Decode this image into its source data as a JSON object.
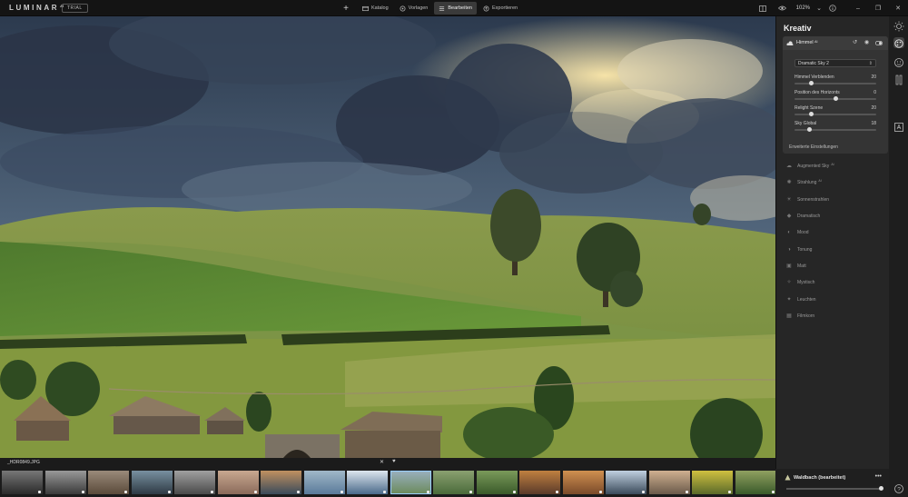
{
  "app": {
    "logo": "LUMINAR",
    "logo_version": "AI",
    "trial_badge": "TRIAL"
  },
  "nav": {
    "add_icon": "plus-icon",
    "tabs": [
      {
        "label": "Katalog",
        "icon": "catalog-icon",
        "active": false
      },
      {
        "label": "Vorlagen",
        "icon": "templates-icon",
        "active": false
      },
      {
        "label": "Bearbeiten",
        "icon": "edit-icon",
        "active": true
      },
      {
        "label": "Exportieren",
        "icon": "export-icon",
        "active": false
      }
    ]
  },
  "toolbar_right": {
    "compare_icon": "compare-icon",
    "preview_icon": "eye-icon",
    "zoom": "102%",
    "zoom_dropdown_icon": "chevron-down-icon",
    "info_icon": "info-icon"
  },
  "window": {
    "minimize": "–",
    "maximize": "❐",
    "close": "✕"
  },
  "panel": {
    "title": "Kreativ",
    "active_tool": {
      "label": "Himmel",
      "badge": "AI",
      "preset": "Dramatic Sky 2",
      "sliders": [
        {
          "label": "Himmel Verblenden",
          "value": "20",
          "fraction": 0.2
        },
        {
          "label": "Position des Horizonts",
          "value": "0",
          "fraction": 0.5
        },
        {
          "label": "Relight Szene",
          "value": "20",
          "fraction": 0.2
        },
        {
          "label": "Sky Global",
          "value": "18",
          "fraction": 0.18
        }
      ],
      "advanced": "Erweiterte Einstellungen"
    },
    "tools": [
      {
        "label": "Augmented Sky",
        "badge": "AI",
        "icon": "sky-icon"
      },
      {
        "label": "Strahlung",
        "badge": "AI",
        "icon": "radiance-icon"
      },
      {
        "label": "Sonnenstrahlen",
        "badge": "",
        "icon": "sunrays-icon"
      },
      {
        "label": "Dramatisch",
        "badge": "",
        "icon": "dramatic-icon"
      },
      {
        "label": "Mood",
        "badge": "",
        "icon": "mood-icon"
      },
      {
        "label": "Tonung",
        "badge": "",
        "icon": "toning-icon"
      },
      {
        "label": "Matt",
        "badge": "",
        "icon": "matte-icon"
      },
      {
        "label": "Mystisch",
        "badge": "",
        "icon": "mystic-icon"
      },
      {
        "label": "Leuchten",
        "badge": "",
        "icon": "glow-icon"
      },
      {
        "label": "Filmkorn",
        "badge": "",
        "icon": "grain-icon"
      }
    ]
  },
  "rail": {
    "icons": [
      "essentials-icon",
      "creative-icon",
      "portrait-icon",
      "professional-icon",
      "canvas-icon"
    ]
  },
  "preset_info": {
    "name": "Waldbach (bearbeitet)",
    "menu": "•••",
    "amount_fraction": 1.0
  },
  "filmstrip": {
    "current_file": "_HDR0849.JPG",
    "close": "✕",
    "favorite": "♥",
    "thumbnail_count": 22,
    "selected_index": 9
  },
  "colors": {
    "accent": "#9ad0ff",
    "panel_bg": "#262626",
    "card_bg": "#343434"
  }
}
